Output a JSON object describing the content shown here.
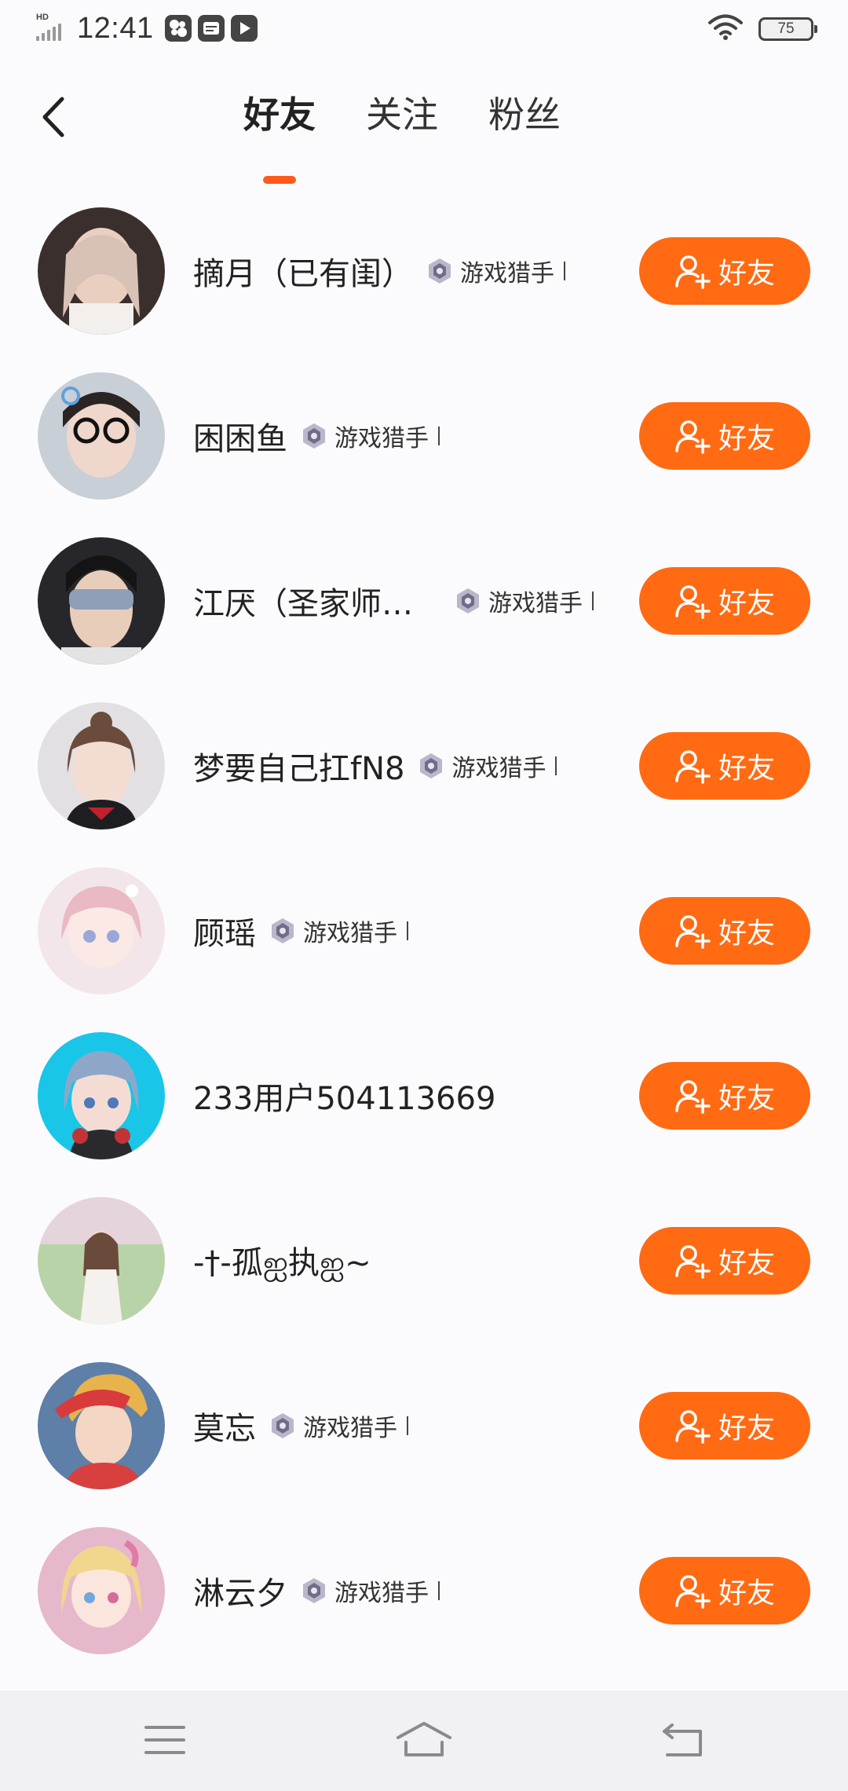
{
  "status_bar": {
    "network_label": "HD",
    "time": "12:41",
    "battery": "75"
  },
  "header": {
    "tabs": [
      {
        "label": "好友",
        "active": true
      },
      {
        "label": "关注",
        "active": false
      },
      {
        "label": "粉丝",
        "active": false
      }
    ]
  },
  "accent_color": "#ff6a13",
  "friends": [
    {
      "name": "摘月（已有闺）",
      "badge": "游戏猎手",
      "button": "好友"
    },
    {
      "name": "困困鱼",
      "badge": "游戏猎手",
      "button": "好友"
    },
    {
      "name": "江厌（圣家师…",
      "badge": "游戏猎手",
      "button": "好友"
    },
    {
      "name": "梦要自己扛fN8",
      "badge": "游戏猎手",
      "button": "好友"
    },
    {
      "name": "顾瑶",
      "badge": "游戏猎手",
      "button": "好友"
    },
    {
      "name": "233用户504113669",
      "badge": "",
      "button": "好友"
    },
    {
      "name": "-†-孤ஐ执ஐ~",
      "badge": "",
      "button": "好友"
    },
    {
      "name": "莫忘",
      "badge": "游戏猎手",
      "button": "好友"
    },
    {
      "name": "淋云夕",
      "badge": "游戏猎手",
      "button": "好友"
    }
  ]
}
